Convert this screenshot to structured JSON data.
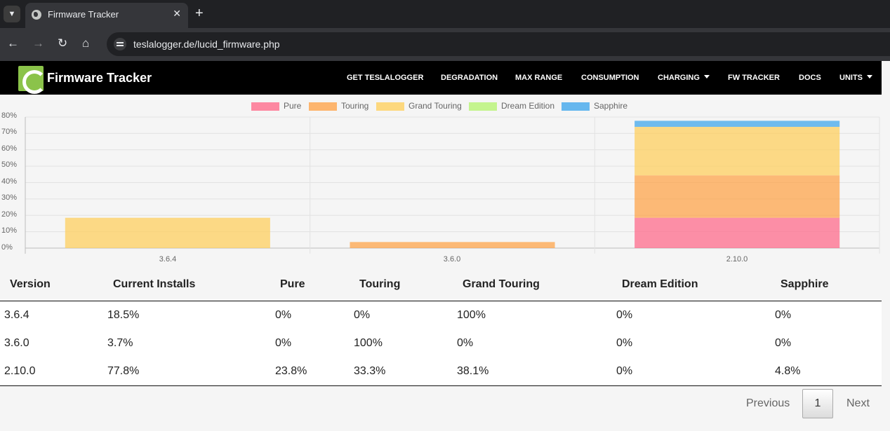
{
  "browser": {
    "tab_title": "Firmware Tracker",
    "url": "teslalogger.de/lucid_firmware.php"
  },
  "navbar": {
    "brand": "Firmware Tracker",
    "items": [
      {
        "label": "GET TESLALOGGER",
        "dropdown": false
      },
      {
        "label": "DEGRADATION",
        "dropdown": false
      },
      {
        "label": "MAX RANGE",
        "dropdown": false
      },
      {
        "label": "CONSUMPTION",
        "dropdown": false
      },
      {
        "label": "CHARGING",
        "dropdown": true
      },
      {
        "label": "FW TRACKER",
        "dropdown": false
      },
      {
        "label": "DOCS",
        "dropdown": false
      },
      {
        "label": "UNITS",
        "dropdown": true
      }
    ]
  },
  "chart_data": {
    "type": "bar",
    "stacked": true,
    "categories": [
      "3.6.4",
      "3.6.0",
      "2.10.0"
    ],
    "series": [
      {
        "name": "Pure",
        "color": "#ff6384",
        "values": [
          0,
          0,
          18.5
        ]
      },
      {
        "name": "Touring",
        "color": "#ff9f40",
        "values": [
          0,
          3.7,
          25.9
        ]
      },
      {
        "name": "Grand Touring",
        "color": "#ffcd56",
        "values": [
          18.5,
          0,
          29.6
        ]
      },
      {
        "name": "Dream Edition",
        "color": "#b3f36b",
        "values": [
          0,
          0,
          0
        ]
      },
      {
        "name": "Sapphire",
        "color": "#36a2eb",
        "values": [
          0,
          0,
          3.7
        ]
      }
    ],
    "yticks": [
      "80%",
      "70%",
      "60%",
      "50%",
      "40%",
      "30%",
      "20%",
      "10%",
      "0%"
    ],
    "ylim": [
      0,
      80
    ],
    "grid": true,
    "legend": "top-center"
  },
  "table": {
    "headers": [
      "Version",
      "Current Installs",
      "Pure",
      "Touring",
      "Grand Touring",
      "Dream Edition",
      "Sapphire"
    ],
    "rows": [
      [
        "3.6.4",
        "18.5%",
        "0%",
        "0%",
        "100%",
        "0%",
        "0%"
      ],
      [
        "3.6.0",
        "3.7%",
        "0%",
        "100%",
        "0%",
        "0%",
        "0%"
      ],
      [
        "2.10.0",
        "77.8%",
        "23.8%",
        "33.3%",
        "38.1%",
        "0%",
        "4.8%"
      ]
    ]
  },
  "pagination": {
    "previous": "Previous",
    "current": "1",
    "next": "Next"
  }
}
